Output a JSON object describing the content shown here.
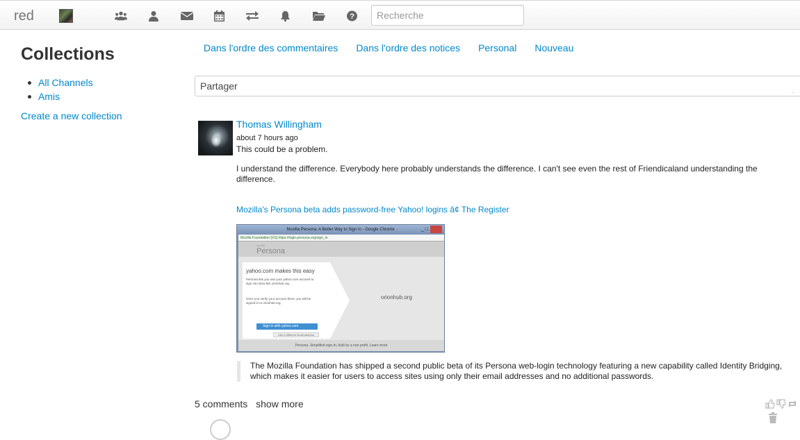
{
  "navbar": {
    "brand": "red",
    "icons": [
      "connections-icon",
      "profile-icon",
      "mail-icon",
      "calendar-icon",
      "exchange-icon",
      "notifications-icon",
      "folder-icon",
      "help-icon"
    ],
    "search_placeholder": "Recherche"
  },
  "sidebar": {
    "title": "Collections",
    "items": [
      {
        "label": "All Channels"
      },
      {
        "label": "Amis"
      }
    ],
    "create_link": "Create a new collection"
  },
  "tabs": [
    {
      "label": "Dans l'ordre des commentaires"
    },
    {
      "label": "Dans l'ordre des notices"
    },
    {
      "label": "Personal"
    },
    {
      "label": "Nouveau"
    }
  ],
  "share": {
    "placeholder": "Partager"
  },
  "post": {
    "author": "Thomas Willingham",
    "time": "about 7 hours ago",
    "body": [
      "This could be a problem.",
      "I understand the difference. Everybody here probably understands the difference. I can't see even the rest of Friendicaland understanding the difference."
    ],
    "link_text": "Mozilla's Persona beta adds password-free Yahoo! logins â¢ The Register",
    "thumbnail": {
      "window_title": "Mozilla Persona: A Better Way to Sign In - Google Chrome",
      "address": "Mozilla Foundation [US] https://login.persona.org/sign_in",
      "logo_small": "mozilla",
      "logo": "Persona",
      "heading": "yahoo.com makes this easy",
      "text1": "Persona lets you use your yahoo.com account to sign into sites like orionhub.org.",
      "text2": "Once you verify your account there, you will be signed in to orionhub.org.",
      "button": "Sign in with yahoo.com",
      "button2": "Use a different email address",
      "site": "orionhub.org",
      "footer": "Persona. Simplified sign-in, built by a non-profit. Learn more"
    },
    "quote": "The Mozilla Foundation has shipped a second public beta of its Persona web-login technology featuring a new capability called Identity Bridging, which makes it easier for users to access sites using only their email addresses and no additional passwords.",
    "comments_count": "5 comments",
    "show_more": "show more"
  }
}
